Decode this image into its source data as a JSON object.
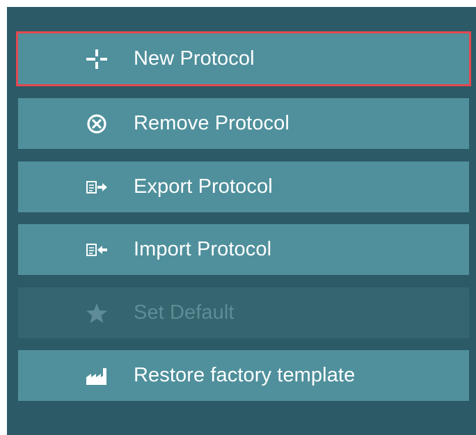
{
  "colors": {
    "panel_bg": "#2c5a66",
    "button_bg": "#4f909c",
    "button_disabled_bg": "#356670",
    "button_text": "#ffffff",
    "disabled_text": "#5f8c96",
    "selection_outline": "#e5474f"
  },
  "menu": {
    "items": [
      {
        "label": "New Protocol",
        "icon": "plus-icon",
        "enabled": true,
        "selected": true
      },
      {
        "label": "Remove Protocol",
        "icon": "remove-circle-icon",
        "enabled": true,
        "selected": false
      },
      {
        "label": "Export Protocol",
        "icon": "export-document-icon",
        "enabled": true,
        "selected": false
      },
      {
        "label": "Import Protocol",
        "icon": "import-document-icon",
        "enabled": true,
        "selected": false
      },
      {
        "label": "Set Default",
        "icon": "star-icon",
        "enabled": false,
        "selected": false
      },
      {
        "label": "Restore factory template",
        "icon": "factory-icon",
        "enabled": true,
        "selected": false
      }
    ]
  }
}
